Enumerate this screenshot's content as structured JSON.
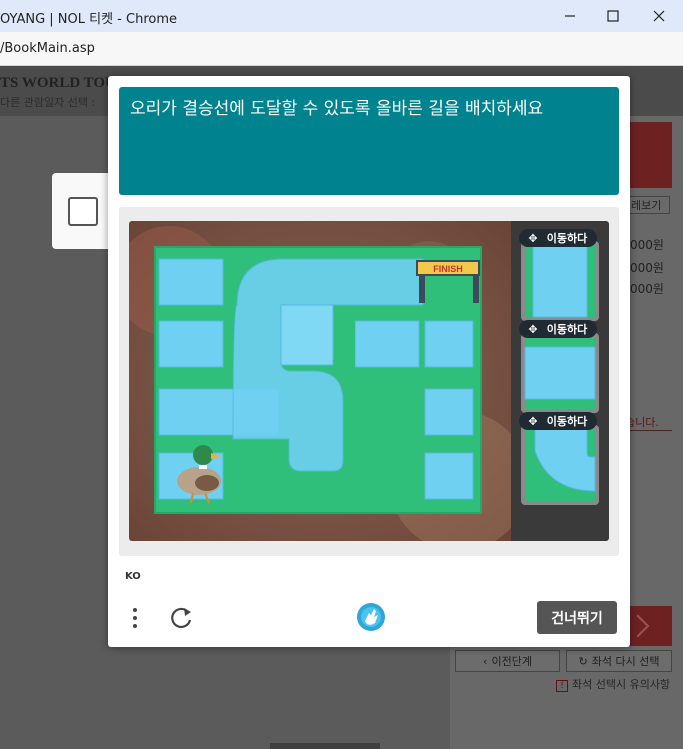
{
  "window": {
    "title": "OYANG | NOL 티켓 - Chrome",
    "url": "/BookMain.asp"
  },
  "background_page": {
    "header_title": "TS WORLD TOU",
    "header_subtitle": "다른 관람일자 선택 :",
    "more_label": "레보기",
    "prices": [
      "000원",
      "000원",
      "000원"
    ],
    "warning_text": "습니다.",
    "prev_step_label": "이전단계",
    "reselect_label": "좌석 다시 선택",
    "caution_label": "좌석 선택시 유의사항"
  },
  "challenge": {
    "prompt": "오리가 결승선에 도달할 수 있도록 올바른 길을 배치하세요",
    "finish_label": "FINISH",
    "move_label": "이동하다",
    "tiles": [
      {
        "type": "straight-vertical",
        "move_label": "이동하다"
      },
      {
        "type": "straight-horizontal",
        "move_label": "이동하다"
      },
      {
        "type": "curve",
        "move_label": "이동하다"
      }
    ],
    "language": "KO",
    "skip_label": "건너뛰기"
  },
  "colors": {
    "prompt_bg": "#00838f",
    "skip_bg": "#555555",
    "grass": "#2fbf7a",
    "water": "#6fd0f2"
  }
}
